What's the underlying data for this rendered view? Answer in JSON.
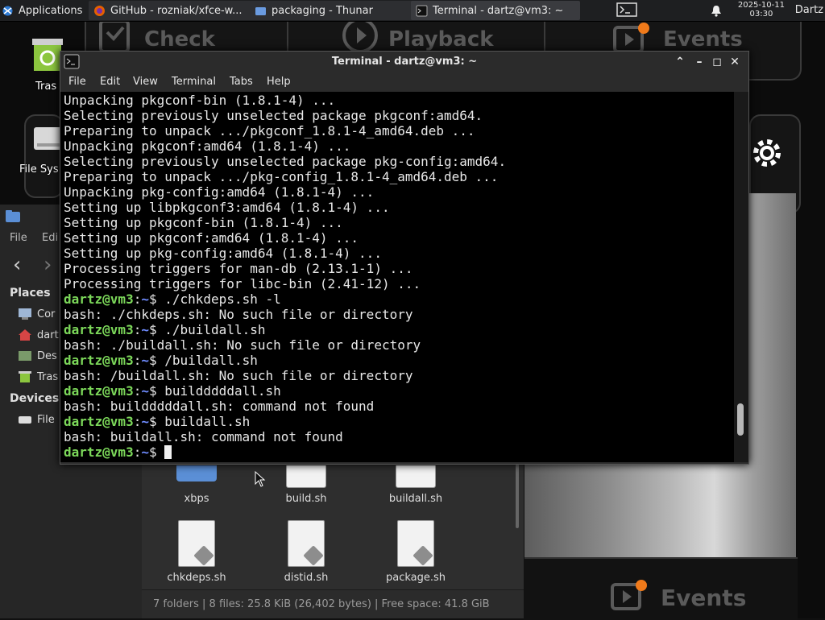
{
  "panel": {
    "applications_label": "Applications",
    "tasks": [
      {
        "label": "GitHub - rozniak/xfce-w...",
        "icon": "firefox-icon"
      },
      {
        "label": "packaging - Thunar",
        "icon": "folder-icon"
      },
      {
        "label": "Terminal - dartz@vm3: ~",
        "icon": "terminal-icon"
      }
    ],
    "date": "2025-10-11",
    "time": "03:30",
    "user": "Dartz"
  },
  "background_app": {
    "tile_labels": [
      "Check",
      "Playback",
      "Events"
    ],
    "bottom_label": "Events"
  },
  "desktop_icons": [
    {
      "label": "Tras",
      "icon": "trash-icon"
    },
    {
      "label": "File Sys",
      "icon": "drive-icon"
    }
  ],
  "thunar": {
    "menu": [
      "File",
      "Edi"
    ],
    "places_heading": "Places",
    "places": [
      {
        "label": "Cor",
        "icon": "computer-icon"
      },
      {
        "label": "dart",
        "icon": "home-icon"
      },
      {
        "label": "Des",
        "icon": "desktop-icon"
      },
      {
        "label": "Tras",
        "icon": "trash-icon"
      }
    ],
    "devices_heading": "Devices",
    "devices": [
      {
        "label": "File",
        "icon": "drive-icon"
      }
    ],
    "files": [
      {
        "name": "xbps",
        "type": "folder"
      },
      {
        "name": "build.sh",
        "type": "script"
      },
      {
        "name": "buildall.sh",
        "type": "script"
      },
      {
        "name": "chkdeps.sh",
        "type": "script"
      },
      {
        "name": "distid.sh",
        "type": "script"
      },
      {
        "name": "package.sh",
        "type": "script"
      }
    ],
    "status": "7 folders  |  8 files: 25.8 KiB (26,402 bytes)  |  Free space: 41.8 GiB"
  },
  "terminal": {
    "title": "Terminal - dartz@vm3: ~",
    "menu": [
      "File",
      "Edit",
      "View",
      "Terminal",
      "Tabs",
      "Help"
    ],
    "prompt_user": "dartz@vm3",
    "prompt_path": "~",
    "lines": [
      {
        "type": "out",
        "text": "Unpacking pkgconf-bin (1.8.1-4) ..."
      },
      {
        "type": "out",
        "text": "Selecting previously unselected package pkgconf:amd64."
      },
      {
        "type": "out",
        "text": "Preparing to unpack .../pkgconf_1.8.1-4_amd64.deb ..."
      },
      {
        "type": "out",
        "text": "Unpacking pkgconf:amd64 (1.8.1-4) ..."
      },
      {
        "type": "out",
        "text": "Selecting previously unselected package pkg-config:amd64."
      },
      {
        "type": "out",
        "text": "Preparing to unpack .../pkg-config_1.8.1-4_amd64.deb ..."
      },
      {
        "type": "out",
        "text": "Unpacking pkg-config:amd64 (1.8.1-4) ..."
      },
      {
        "type": "out",
        "text": "Setting up libpkgconf3:amd64 (1.8.1-4) ..."
      },
      {
        "type": "out",
        "text": "Setting up pkgconf-bin (1.8.1-4) ..."
      },
      {
        "type": "out",
        "text": "Setting up pkgconf:amd64 (1.8.1-4) ..."
      },
      {
        "type": "out",
        "text": "Setting up pkg-config:amd64 (1.8.1-4) ..."
      },
      {
        "type": "out",
        "text": "Processing triggers for man-db (2.13.1-1) ..."
      },
      {
        "type": "out",
        "text": "Processing triggers for libc-bin (2.41-12) ..."
      },
      {
        "type": "cmd",
        "text": "./chkdeps.sh -l"
      },
      {
        "type": "out",
        "text": "bash: ./chkdeps.sh: No such file or directory"
      },
      {
        "type": "cmd",
        "text": "./buildall.sh"
      },
      {
        "type": "out",
        "text": "bash: ./buildall.sh: No such file or directory"
      },
      {
        "type": "cmd",
        "text": "/buildall.sh"
      },
      {
        "type": "out",
        "text": "bash: /buildall.sh: No such file or directory"
      },
      {
        "type": "cmd",
        "text": "buildddddall.sh"
      },
      {
        "type": "out",
        "text": "bash: buildddddall.sh: command not found"
      },
      {
        "type": "cmd",
        "text": "buildall.sh"
      },
      {
        "type": "out",
        "text": "bash: buildall.sh: command not found"
      },
      {
        "type": "cmd",
        "text": ""
      }
    ],
    "scroll_position": 0.93
  },
  "colors": {
    "prompt_user": "#7cd85a",
    "prompt_path": "#6f8cff",
    "panel_bg": "#1e1f21"
  }
}
